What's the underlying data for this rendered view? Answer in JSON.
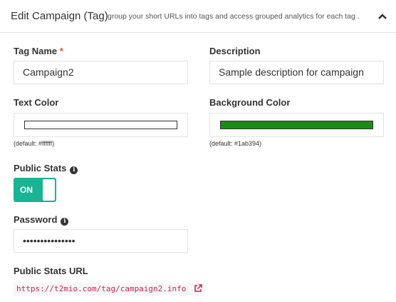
{
  "header": {
    "title": "Edit Campaign (Tag)",
    "description": "group your short URLs into tags and access grouped analytics for each tag .",
    "collapse_icon": "chevron-up-icon"
  },
  "form": {
    "tag_name": {
      "label": "Tag Name",
      "required_mark": "*",
      "value": "Campaign2"
    },
    "description": {
      "label": "Description",
      "value": "Sample description for campaign"
    },
    "text_color": {
      "label": "Text Color",
      "value": "#ffffff",
      "hint": "(default: #ffffff)"
    },
    "background_color": {
      "label": "Background Color",
      "value": "#1a8c14",
      "hint": "(default: #1ab394)"
    },
    "public_stats": {
      "label": "Public Stats",
      "info_icon": "info-icon",
      "toggle_label": "ON",
      "enabled": true,
      "accent": "#1ab394"
    },
    "password": {
      "label": "Password",
      "info_icon": "info-icon",
      "value": "•••••••••••••••"
    },
    "public_stats_url": {
      "label": "Public Stats URL",
      "url": "https://t2mio.com/tag/campaign2.info",
      "link_icon": "external-link-icon",
      "link_color": "#c7254e"
    }
  }
}
